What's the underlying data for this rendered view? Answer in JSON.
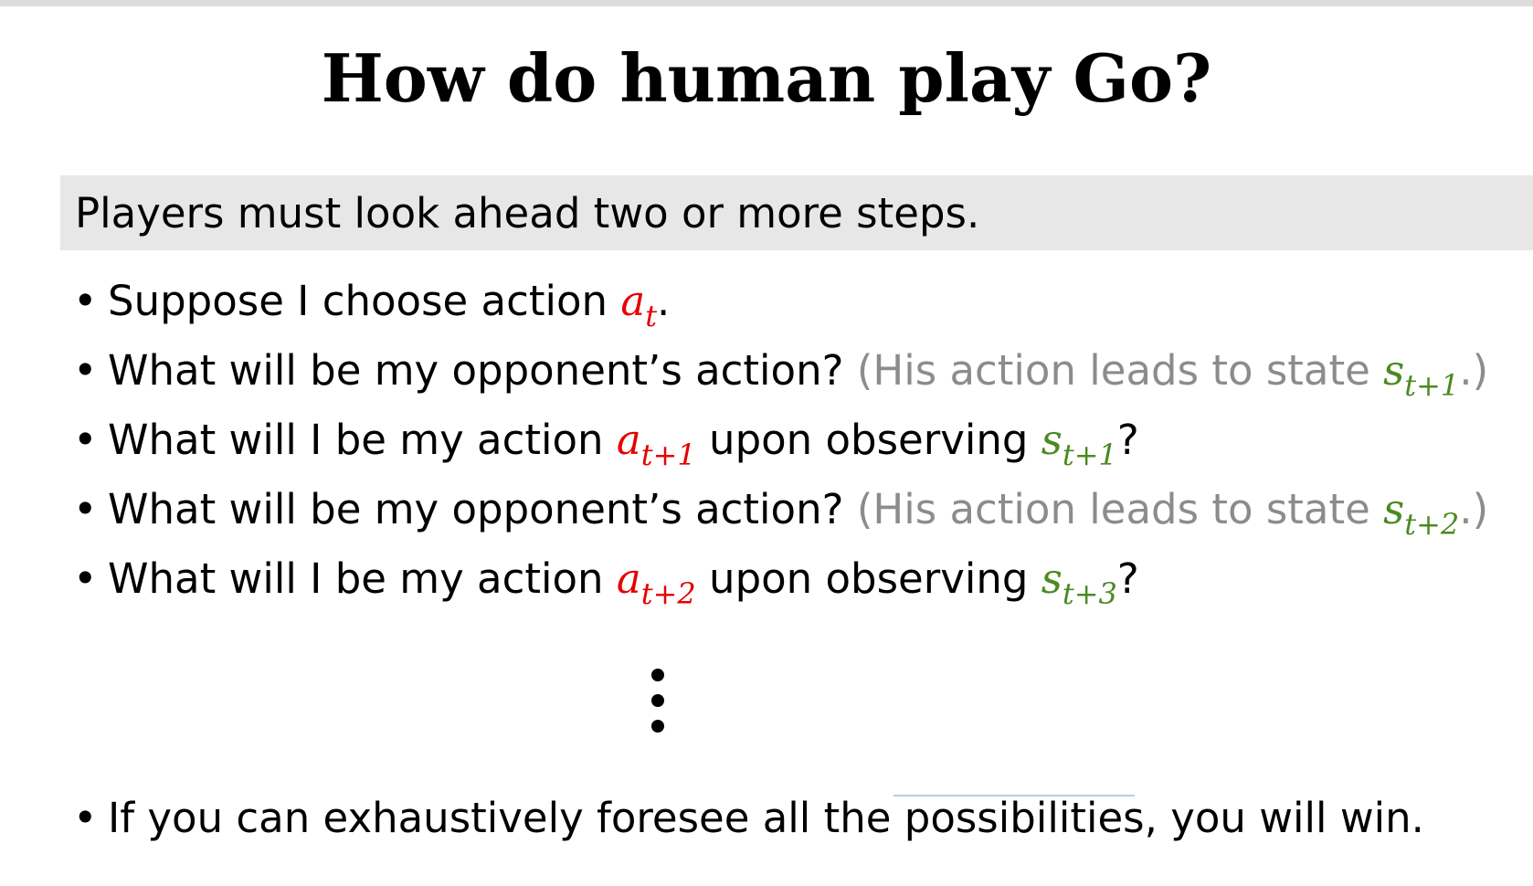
{
  "title": "How do human play Go?",
  "banner": "Players must look ahead two or more steps.",
  "bullet_symbol": "•",
  "colors": {
    "action": "#e60000",
    "state": "#4b8a22",
    "aside": "#8c8c8c"
  },
  "bullets": [
    {
      "pre": "Suppose I choose action ",
      "var": "a",
      "sub": "t",
      "post": "."
    },
    {
      "pre": "What will be my opponent’s action? ",
      "aside": "(His action leads to state ",
      "var": "s",
      "sub": "t+1",
      "post": ".)"
    },
    {
      "pre": "What will I be my action ",
      "var": "a",
      "sub": "t+1",
      "mid": " upon observing ",
      "var2": "s",
      "sub2": "t+1",
      "post": "?"
    },
    {
      "pre": "What will be my opponent’s action? ",
      "aside": "(His action leads to state ",
      "var": "s",
      "sub": "t+2",
      "post": ".)"
    },
    {
      "pre": "What will I be my action ",
      "var": "a",
      "sub": "t+2",
      "mid": " upon observing ",
      "var2": "s",
      "sub2": "t+3",
      "post": "?"
    }
  ],
  "continuation": "⋮",
  "conclusion": "If you can exhaustively foresee all the possibilities, you will win."
}
